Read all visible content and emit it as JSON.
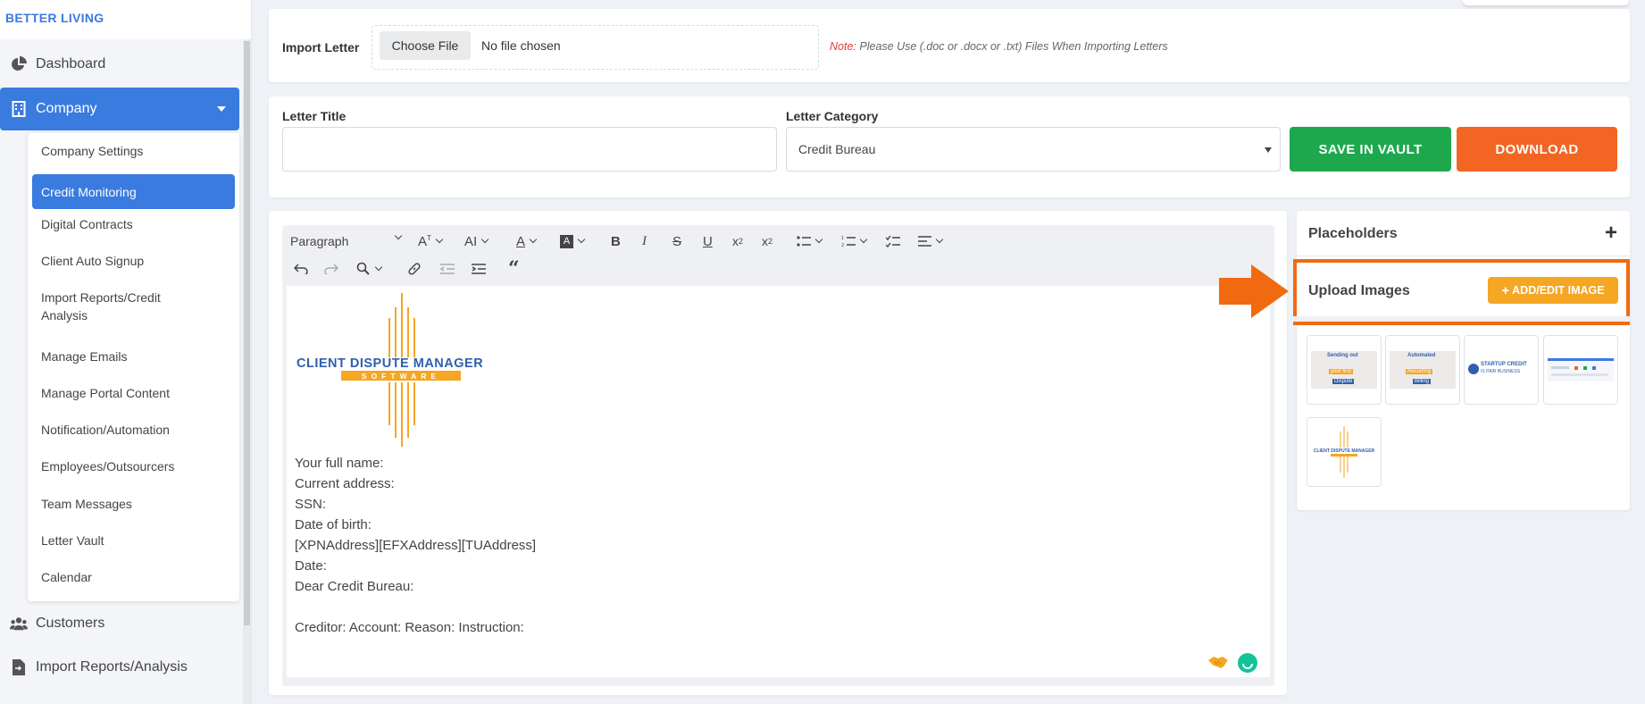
{
  "brand": "BETTER LIVING",
  "sidebar": {
    "items": [
      {
        "label": "Dashboard",
        "icon": "pie-chart-icon"
      },
      {
        "label": "Company",
        "icon": "building-icon"
      },
      {
        "label": "Customers",
        "icon": "users-icon"
      },
      {
        "label": "Import Reports/Analysis",
        "icon": "file-import-icon"
      }
    ],
    "submenu": [
      "Company Settings",
      "Credit Monitoring",
      "Digital Contracts",
      "Client Auto Signup",
      "Import Reports/Credit Analysis",
      "Manage Emails",
      "Manage Portal Content",
      "Notification/Automation",
      "Employees/Outsourcers",
      "Team Messages",
      "Letter Vault",
      "Calendar"
    ]
  },
  "import": {
    "label": "Import Letter",
    "choose_file": "Choose File",
    "no_file": "No file chosen",
    "note_prefix": "Note:",
    "note_text": "Please Use (.doc or .docx or .txt) Files When Importing Letters"
  },
  "form": {
    "title_label": "Letter Title",
    "title_value": "",
    "category_label": "Letter Category",
    "category_value": "Credit Bureau",
    "save_label": "SAVE IN VAULT",
    "download_label": "DOWNLOAD"
  },
  "toolbar": {
    "paragraph": "Paragraph"
  },
  "editor": {
    "logo_line1": "CLIENT DISPUTE MANAGER",
    "logo_line2": "SOFTWARE",
    "lines": [
      "Your full name:",
      "Current address:",
      "SSN:",
      "Date of birth:",
      "[XPNAddress][EFXAddress][TUAddress]",
      "Date:",
      "Dear Credit Bureau:",
      "",
      "Creditor: Account: Reason: Instruction:"
    ]
  },
  "right_panel": {
    "placeholders_label": "Placeholders",
    "upload_label": "Upload Images",
    "add_edit_label": "ADD/EDIT IMAGE",
    "thumbs": [
      {
        "line1": "Sending out",
        "line2": "your first",
        "line3": "Dispute"
      },
      {
        "line1": "Automated",
        "line2": "Recurring",
        "line3": "Billing"
      },
      {
        "line1": "STARTUP CREDIT",
        "line2": "IS PAIR BUSINESS",
        "line3": ""
      },
      {
        "line1": "",
        "line2": "",
        "line3": ""
      },
      {
        "line1": "CLIENT DISPUTE MANAGER",
        "line2": "",
        "line3": ""
      }
    ]
  },
  "colors": {
    "accent": "#3a7be0",
    "save": "#1ea84e",
    "download": "#f26522",
    "highlight": "#f26a10",
    "logo_orange": "#f5a623",
    "logo_blue": "#2f5fae"
  }
}
